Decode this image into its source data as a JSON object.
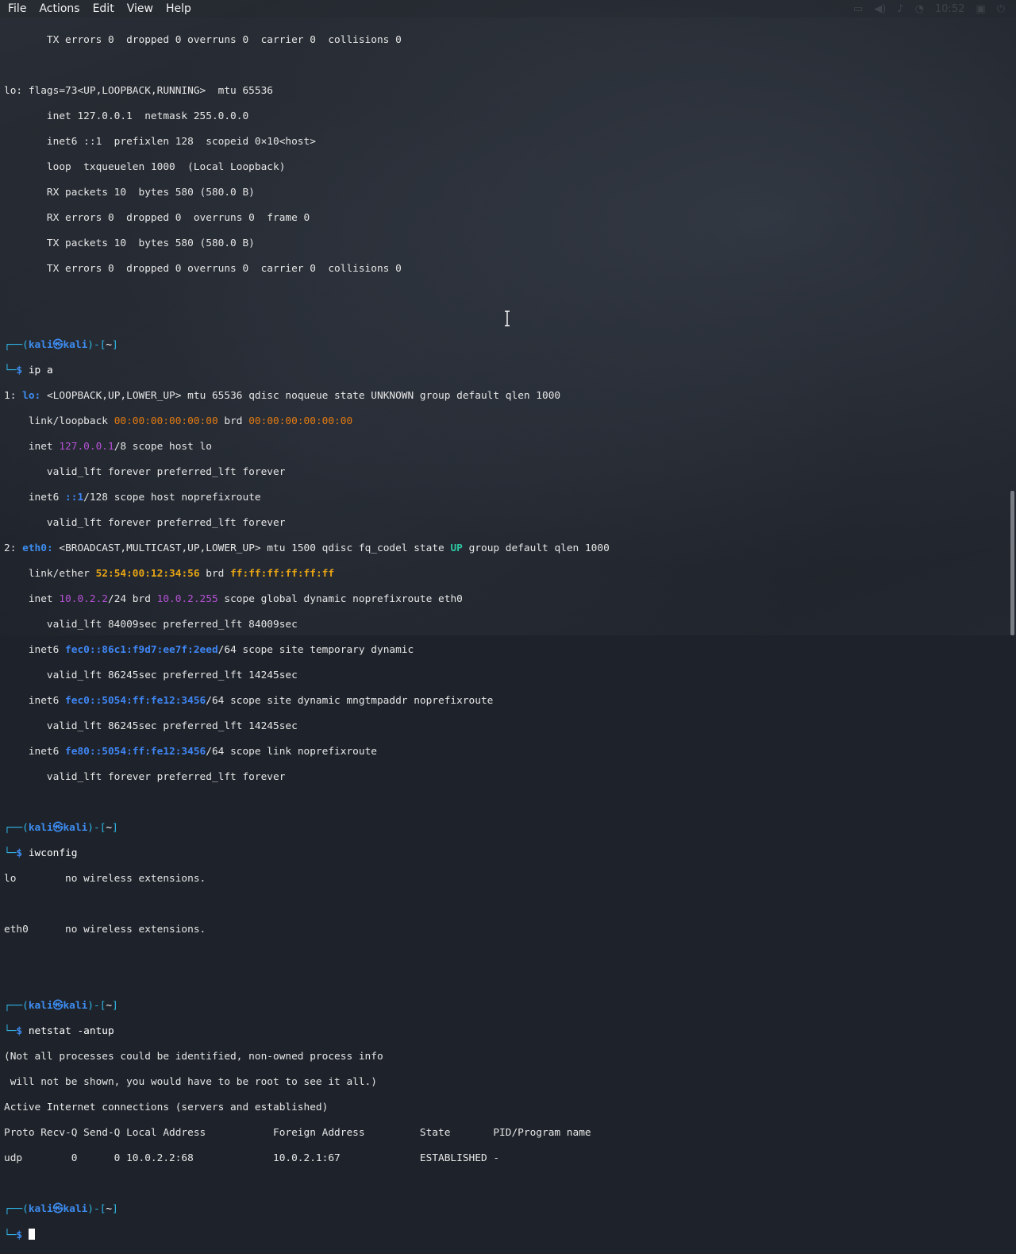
{
  "menu": {
    "file": "File",
    "actions": "Actions",
    "edit": "Edit",
    "view": "View",
    "help": "Help"
  },
  "tray": {
    "clock": "10:52"
  },
  "prompt": {
    "open": "┌──(",
    "user": "kali",
    "at": "㉿",
    "host": "kali",
    "mid": ")-[",
    "path": "~",
    "close": "]",
    "bottom": "└─",
    "dollar": "$ "
  },
  "lines": {
    "l1": "       TX errors 0  dropped 0 overruns 0  carrier 0  collisions 0",
    "l3": "lo: flags=73<UP,LOOPBACK,RUNNING>  mtu 65536",
    "l4": "       inet 127.0.0.1  netmask 255.0.0.0",
    "l5": "       inet6 ::1  prefixlen 128  scopeid 0×10<host>",
    "l6": "       loop  txqueuelen 1000  (Local Loopback)",
    "l7": "       RX packets 10  bytes 580 (580.0 B)",
    "l8": "       RX errors 0  dropped 0  overruns 0  frame 0",
    "l9": "       TX packets 10  bytes 580 (580.0 B)",
    "l10": "       TX errors 0  dropped 0 overruns 0  carrier 0  collisions 0"
  },
  "cmd1": "ip a",
  "ipa": {
    "a1_pre": "1: ",
    "a1_if": "lo:",
    "a1_rest": " <LOOPBACK,UP,LOWER_UP> mtu 65536 qdisc noqueue state UNKNOWN group default qlen 1000",
    "a2_pre": "    link/loopback ",
    "a2_mac": "00:00:00:00:00:00",
    "a2_mid": " brd ",
    "a2_brd": "00:00:00:00:00:00",
    "a3_pre": "    inet ",
    "a3_ip": "127.0.0.1",
    "a3_rest": "/8 scope host lo",
    "a4": "       valid_lft forever preferred_lft forever",
    "a5_pre": "    inet6 ",
    "a5_ip": "::1",
    "a5_rest": "/128 scope host noprefixroute",
    "a6": "       valid_lft forever preferred_lft forever",
    "a7_pre": "2: ",
    "a7_if": "eth0:",
    "a7_mid": " <BROADCAST,MULTICAST,UP,LOWER_UP> mtu 1500 qdisc fq_codel state ",
    "a7_state": "UP",
    "a7_rest": " group default qlen 1000",
    "a8_pre": "    link/ether ",
    "a8_mac": "52:54:00:12:34:56",
    "a8_mid": " brd ",
    "a8_brd": "ff:ff:ff:ff:ff:ff",
    "a9_pre": "    inet ",
    "a9_ip": "10.0.2.2",
    "a9_mid": "/24 brd ",
    "a9_brd": "10.0.2.255",
    "a9_rest": " scope global dynamic noprefixroute eth0",
    "a10": "       valid_lft 84009sec preferred_lft 84009sec",
    "a11_pre": "    inet6 ",
    "a11_ip": "fec0::86c1:f9d7:ee7f:2eed",
    "a11_rest": "/64 scope site temporary dynamic",
    "a12": "       valid_lft 86245sec preferred_lft 14245sec",
    "a13_pre": "    inet6 ",
    "a13_ip": "fec0::5054:ff:fe12:3456",
    "a13_rest": "/64 scope site dynamic mngtmpaddr noprefixroute",
    "a14": "       valid_lft 86245sec preferred_lft 14245sec",
    "a15_pre": "    inet6 ",
    "a15_ip": "fe80::5054:ff:fe12:3456",
    "a15_rest": "/64 scope link noprefixroute",
    "a16": "       valid_lft forever preferred_lft forever"
  },
  "cmd2": "iwconfig",
  "iw": {
    "w1": "lo        no wireless extensions.",
    "w2": "eth0      no wireless extensions."
  },
  "cmd3": "netstat -antup",
  "ns": {
    "n1": "(Not all processes could be identified, non-owned process info",
    "n2": " will not be shown, you would have to be root to see it all.)",
    "n3": "Active Internet connections (servers and established)",
    "n4": "Proto Recv-Q Send-Q Local Address           Foreign Address         State       PID/Program name",
    "n5": "udp        0      0 10.0.2.2:68             10.0.2.1:67             ESTABLISHED -"
  }
}
